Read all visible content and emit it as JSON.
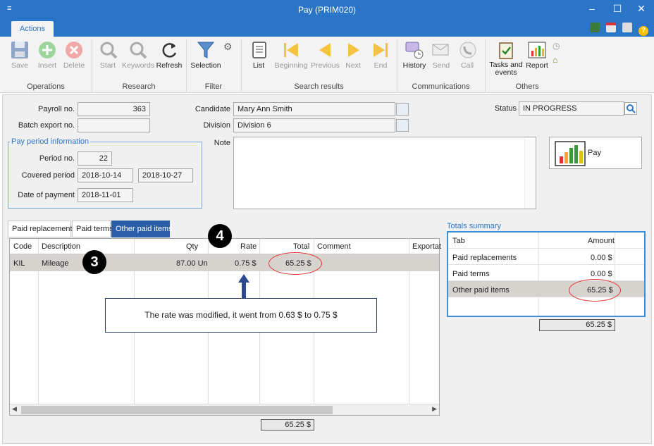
{
  "window": {
    "title": "Pay (PRIM020)"
  },
  "ribbon": {
    "tab": "Actions",
    "buttons": {
      "save": "Save",
      "insert": "Insert",
      "delete": "Delete",
      "start": "Start",
      "keywords": "Keywords",
      "refresh": "Refresh",
      "selection": "Selection",
      "list": "List",
      "beginning": "Beginning",
      "previous": "Previous",
      "next": "Next",
      "end": "End",
      "history": "History",
      "send": "Send",
      "call": "Call",
      "tasks": "Tasks and events",
      "report": "Report"
    },
    "groups": {
      "operations": "Operations",
      "research": "Research",
      "filter": "Filter",
      "search_results": "Search results",
      "communications": "Communications",
      "others": "Others"
    }
  },
  "form": {
    "payroll_label": "Payroll no.",
    "payroll_value": "363",
    "batch_label": "Batch export no.",
    "batch_value": "",
    "candidate_label": "Candidate",
    "candidate_value": "Mary Ann Smith",
    "division_label": "Division",
    "division_value": "Division 6",
    "status_label": "Status",
    "status_value": "IN PROGRESS",
    "note_label": "Note",
    "pay_button": "Pay",
    "pay_period": {
      "title": "Pay period information",
      "period_label": "Period no.",
      "period_value": "22",
      "covered_label": "Covered period",
      "covered_from": "2018-10-14",
      "covered_to": "2018-10-27",
      "date_label": "Date of payment",
      "date_value": "2018-11-01"
    }
  },
  "tabs": [
    "Paid replacements",
    "Paid terms",
    "Other paid items"
  ],
  "grid": {
    "columns": [
      "Code",
      "Description",
      "Qty",
      "Rate",
      "Total",
      "Comment",
      "Exportat"
    ],
    "rows": [
      {
        "code": "KIL",
        "description": "Mileage",
        "qty": "87.00 Un",
        "rate": "0.75 $",
        "total": "65.25 $",
        "comment": ""
      }
    ],
    "total": "65.25 $"
  },
  "summary": {
    "title": "Totals summary",
    "headers": [
      "Tab",
      "Amount"
    ],
    "rows": [
      {
        "tab": "Paid replacements",
        "amount": "0.00 $"
      },
      {
        "tab": "Paid terms",
        "amount": "0.00 $"
      },
      {
        "tab": "Other paid items",
        "amount": "65.25 $"
      }
    ],
    "total": "65.25 $"
  },
  "annotations": {
    "marker3": "3",
    "marker4": "4",
    "callout": "The rate was modified, it went from 0.63 $ to 0.75 $"
  }
}
